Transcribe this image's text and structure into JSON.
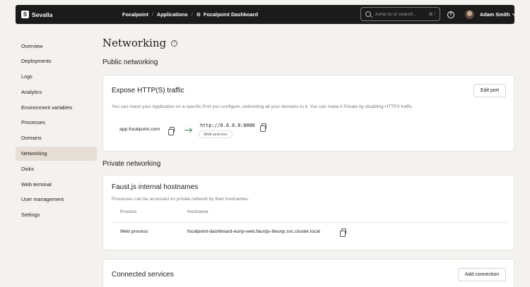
{
  "topbar": {
    "logo_glyph": "S",
    "app_name": "Sevalla",
    "breadcrumb": [
      "Focalpoint",
      "Applications",
      "Focalpoint Dashboard"
    ],
    "search_placeholder": "Jump to or search...",
    "search_shortcut": "⌘ /",
    "help_glyph": "?",
    "user_name": "Adam Smith"
  },
  "sidebar": {
    "items": [
      {
        "label": "Overview"
      },
      {
        "label": "Deployments"
      },
      {
        "label": "Logs"
      },
      {
        "label": "Analytics"
      },
      {
        "label": "Environment variables"
      },
      {
        "label": "Processes"
      },
      {
        "label": "Domains"
      },
      {
        "label": "Networking",
        "active": true
      },
      {
        "label": "Disks"
      },
      {
        "label": "Web terminal"
      },
      {
        "label": "User management"
      },
      {
        "label": "Settings"
      }
    ]
  },
  "page": {
    "title": "Networking",
    "help_glyph": "?"
  },
  "public": {
    "heading": "Public networking",
    "card_title": "Expose HTTP(S) traffic",
    "edit_button": "Edit port",
    "description": "You can reach your Application on a specific Port you configure, redirecting all your domains to it. You can make it Private by disabling HTTPS traffic.",
    "domain": "app.focalpoint.com",
    "target_url": "http://0.0.0.0:8080",
    "target_process": "Web process"
  },
  "private": {
    "heading": "Private networking",
    "card_title": "Faust.js internal hostnames",
    "description": "Processes can be accessed on private network by their hostnames.",
    "columns": [
      "Process",
      "Hostname"
    ],
    "rows": [
      {
        "process": "Web process",
        "hostname": "focalpoint-dashboard-eunp-web.faustjs-8eunp.svc.cluster.local"
      }
    ]
  },
  "services": {
    "card_title": "Connected services",
    "add_button": "Add connection"
  },
  "colors": {
    "topbar": "#1b1b1b",
    "background": "#f3f2ef",
    "active_nav": "#e7ded6",
    "arrow": "#2f8f57"
  }
}
